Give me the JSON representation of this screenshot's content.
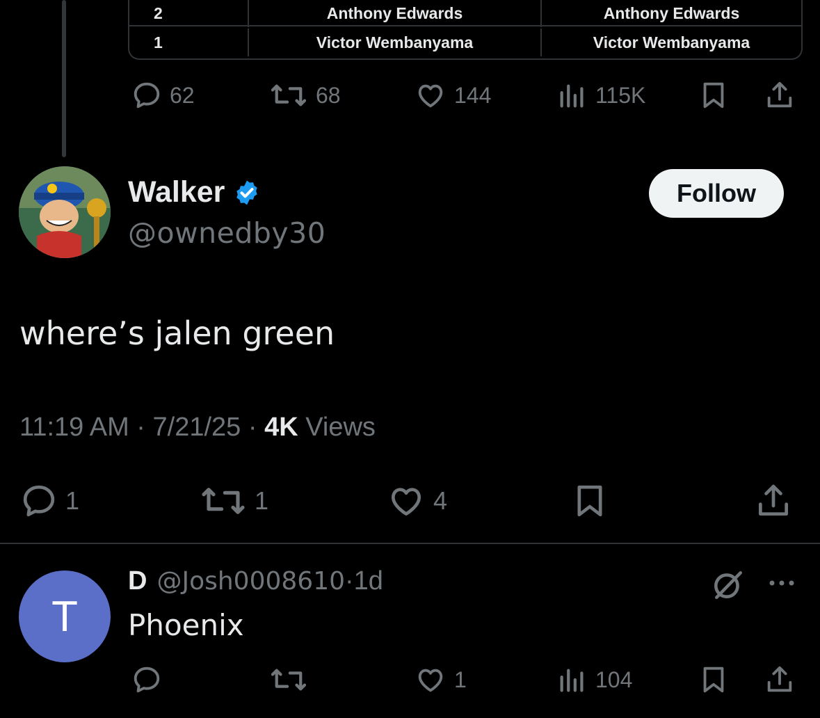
{
  "quoted_table": {
    "rows": [
      {
        "rank": "2",
        "col_a": "Anthony Edwards",
        "col_b": "Anthony Edwards"
      },
      {
        "rank": "1",
        "col_a": "Victor Wembanyama",
        "col_b": "Victor Wembanyama"
      }
    ]
  },
  "parent_actions": {
    "replies": "62",
    "reposts": "68",
    "likes": "144",
    "views": "115K"
  },
  "tweet": {
    "display_name": "Walker",
    "verified_icon": "verified-badge-icon",
    "handle": "@ownedby30",
    "follow_label": "Follow",
    "text": "where’s jalen green",
    "time": "11:19 AM",
    "date": "7/21/25",
    "views_count": "4K",
    "views_label": "Views",
    "replies": "1",
    "reposts": "1",
    "likes": "4"
  },
  "reply": {
    "avatar_letter": "T",
    "avatar_color": "#5b6ec8",
    "display_name": "D",
    "handle": "@Josh0008610",
    "age": "1d",
    "text": "Phoenix",
    "likes": "1",
    "views": "104"
  },
  "colors": {
    "background": "#000000",
    "muted": "#71767b",
    "text": "#e7e9ea",
    "verified": "#1d9bf0"
  }
}
